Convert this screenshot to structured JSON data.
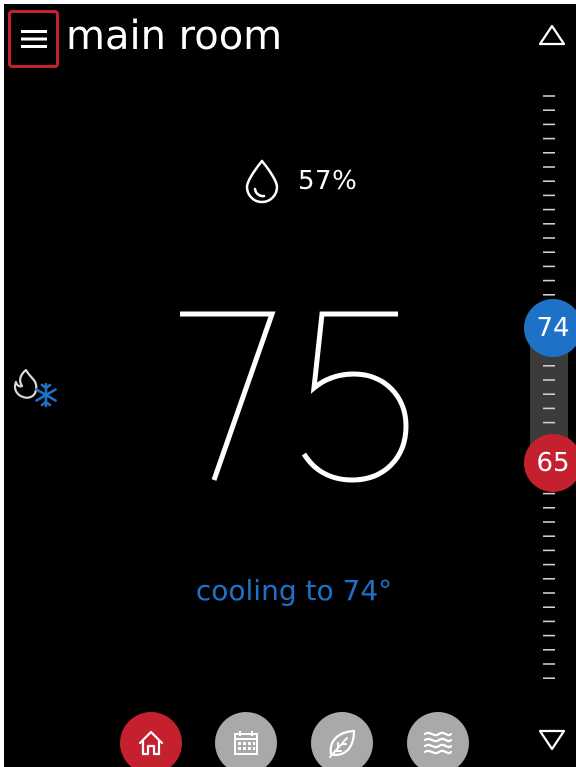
{
  "header": {
    "title": "main room",
    "menu_icon": "hamburger-menu-icon",
    "up_icon": "triangle-up-icon"
  },
  "humidity": {
    "icon": "water-drop-icon",
    "value": "57%"
  },
  "current_temperature": "75",
  "mode": {
    "icon": "heat-cool-mode-icon"
  },
  "status_text": "cooling to 74°",
  "setpoints": {
    "cool": "74",
    "heat": "65"
  },
  "nav": {
    "items": [
      {
        "name": "home",
        "icon": "home-icon",
        "active": true
      },
      {
        "name": "schedule",
        "icon": "calendar-icon",
        "active": false
      },
      {
        "name": "eco",
        "icon": "leaf-icon",
        "active": false
      },
      {
        "name": "fan",
        "icon": "airflow-icon",
        "active": false
      }
    ],
    "down_icon": "triangle-down-icon"
  },
  "colors": {
    "background": "#000000",
    "accent_red": "#c4202e",
    "accent_blue": "#1d72c7",
    "inactive_nav": "#a9a9a9",
    "text": "#ffffff"
  }
}
